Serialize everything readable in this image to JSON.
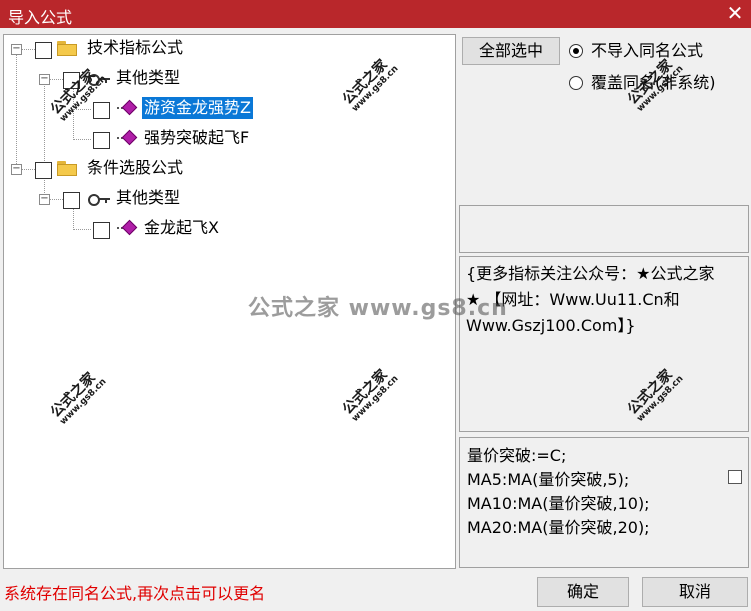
{
  "window": {
    "title": "导入公式",
    "close_glyph": "✕"
  },
  "tree": {
    "nodes": [
      {
        "label": "技术指标公式",
        "icon": "folder-icon"
      },
      {
        "label": "其他类型",
        "icon": "key-icon"
      },
      {
        "label": "游资金龙强势Z",
        "icon": "formula-icon",
        "selected": true
      },
      {
        "label": "强势突破起飞F",
        "icon": "formula-icon"
      },
      {
        "label": "条件选股公式",
        "icon": "folder-icon"
      },
      {
        "label": "其他类型",
        "icon": "key-icon"
      },
      {
        "label": "金龙起飞X",
        "icon": "formula-icon"
      }
    ],
    "expander_glyph": "−"
  },
  "options": {
    "select_all_label": "全部选中",
    "radio_skip_label": "不导入同名公式",
    "radio_overwrite_label": "覆盖同名(非系统)",
    "selected_radio": "skip"
  },
  "description": "{更多指标关注公众号：★公式之家★ 【网址：Www.Uu11.Cn和Www.Gszj100.Com】}",
  "code_lines": [
    "量价突破:=C;",
    "MA5:MA(量价突破,5);",
    "MA10:MA(量价突破,10);",
    "MA20:MA(量价突破,20);"
  ],
  "status": {
    "message": "系统存在同名公式,再次点击可以更名",
    "color": "#e00000"
  },
  "buttons": {
    "ok": "确定",
    "cancel": "取消"
  },
  "watermark": {
    "center_text": "公式之家 www.gs8.cn",
    "stamp_text": "公式之家",
    "stamp_url": "www.gs8.cn"
  },
  "colors": {
    "titlebar": "#b9272b",
    "selection": "#0a78d7"
  }
}
